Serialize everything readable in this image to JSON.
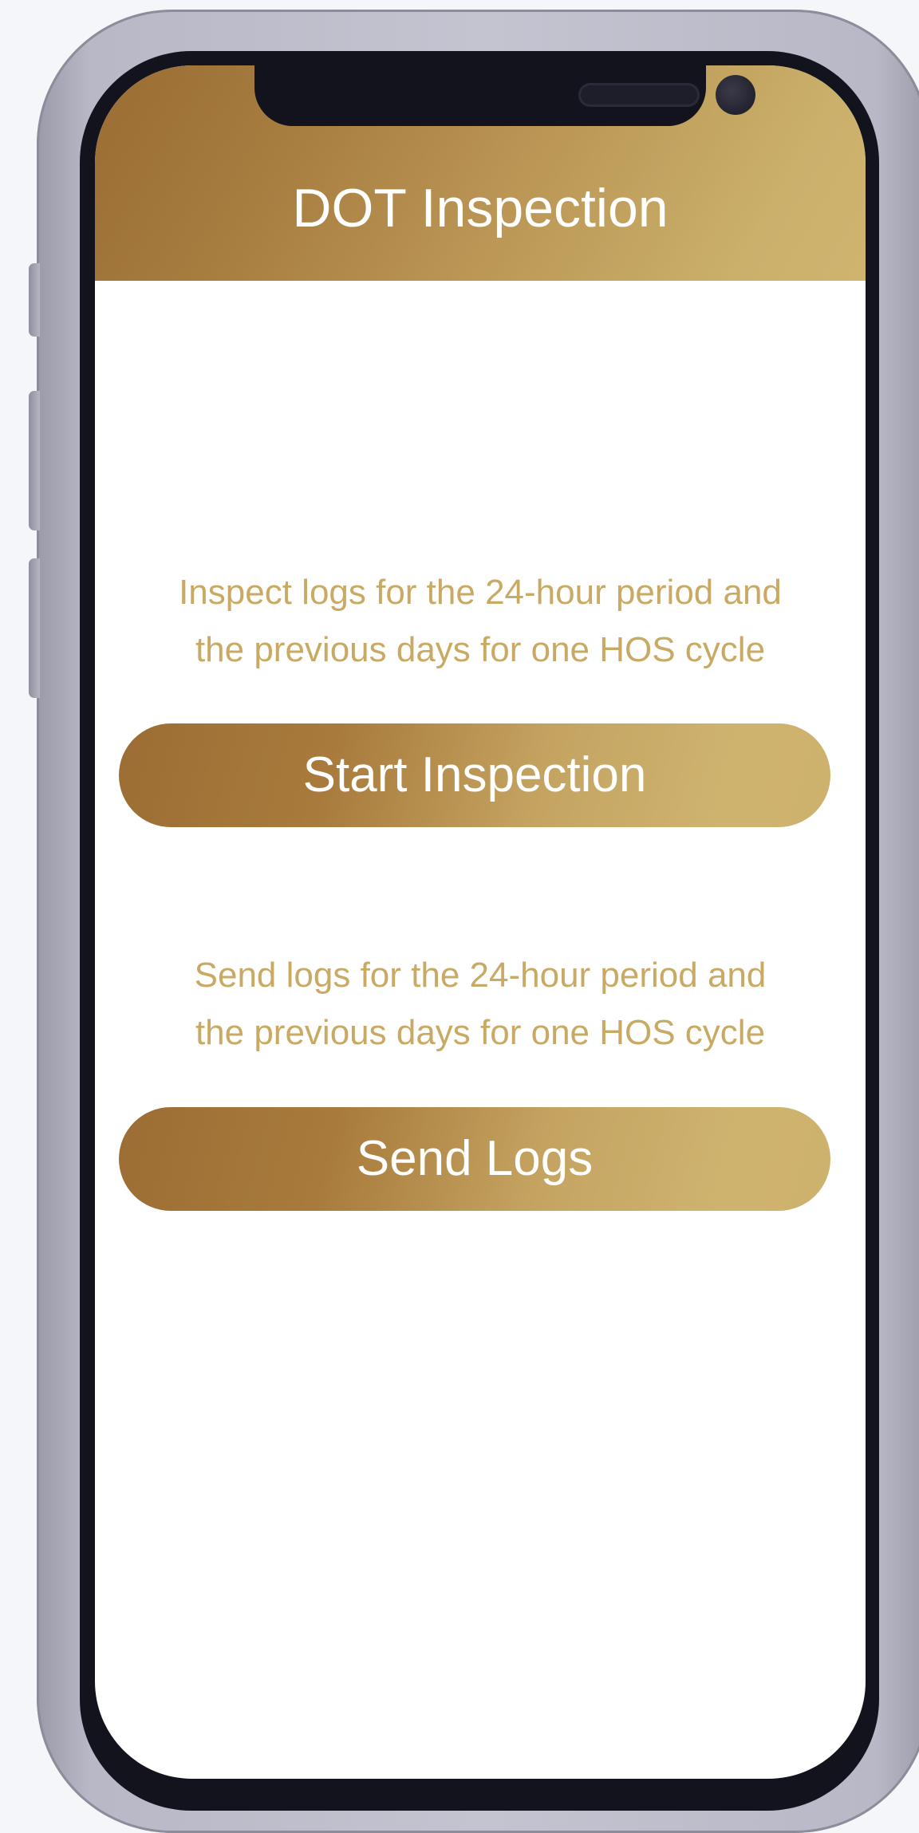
{
  "header": {
    "title": "DOT Inspection"
  },
  "inspection": {
    "description_line1": "Inspect logs for the 24-hour period and",
    "description_line2": "the previous days for one HOS cycle",
    "button_label": "Start Inspection"
  },
  "send": {
    "description_line1": "Send logs for the 24-hour period and",
    "description_line2": "the previous days for one HOS cycle",
    "button_label": "Send Logs"
  },
  "colors": {
    "accent_dark": "#9c6d34",
    "accent_light": "#ceb36f",
    "text_accent": "#c9aa65"
  }
}
